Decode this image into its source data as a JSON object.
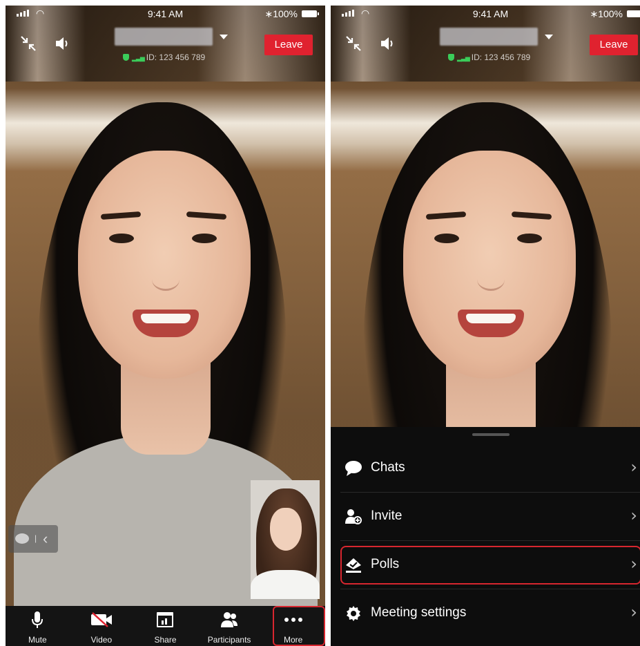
{
  "status_bar": {
    "time": "9:41 AM",
    "battery": "100%"
  },
  "meeting": {
    "id_text": "ID: 123 456 789",
    "leave_label": "Leave"
  },
  "toolbar": {
    "mute_label": "Mute",
    "video_label": "Video",
    "share_label": "Share",
    "participants_label": "Participants",
    "more_label": "More"
  },
  "more_menu": {
    "items": [
      {
        "label": "Chats",
        "icon": "chat-icon"
      },
      {
        "label": "Invite",
        "icon": "add-user-icon"
      },
      {
        "label": "Polls",
        "icon": "poll-icon"
      },
      {
        "label": "Meeting settings",
        "icon": "gear-icon"
      }
    ]
  },
  "colors": {
    "leave": "#e0222f",
    "highlight": "#d8262f",
    "secure": "#3bcc5a"
  }
}
